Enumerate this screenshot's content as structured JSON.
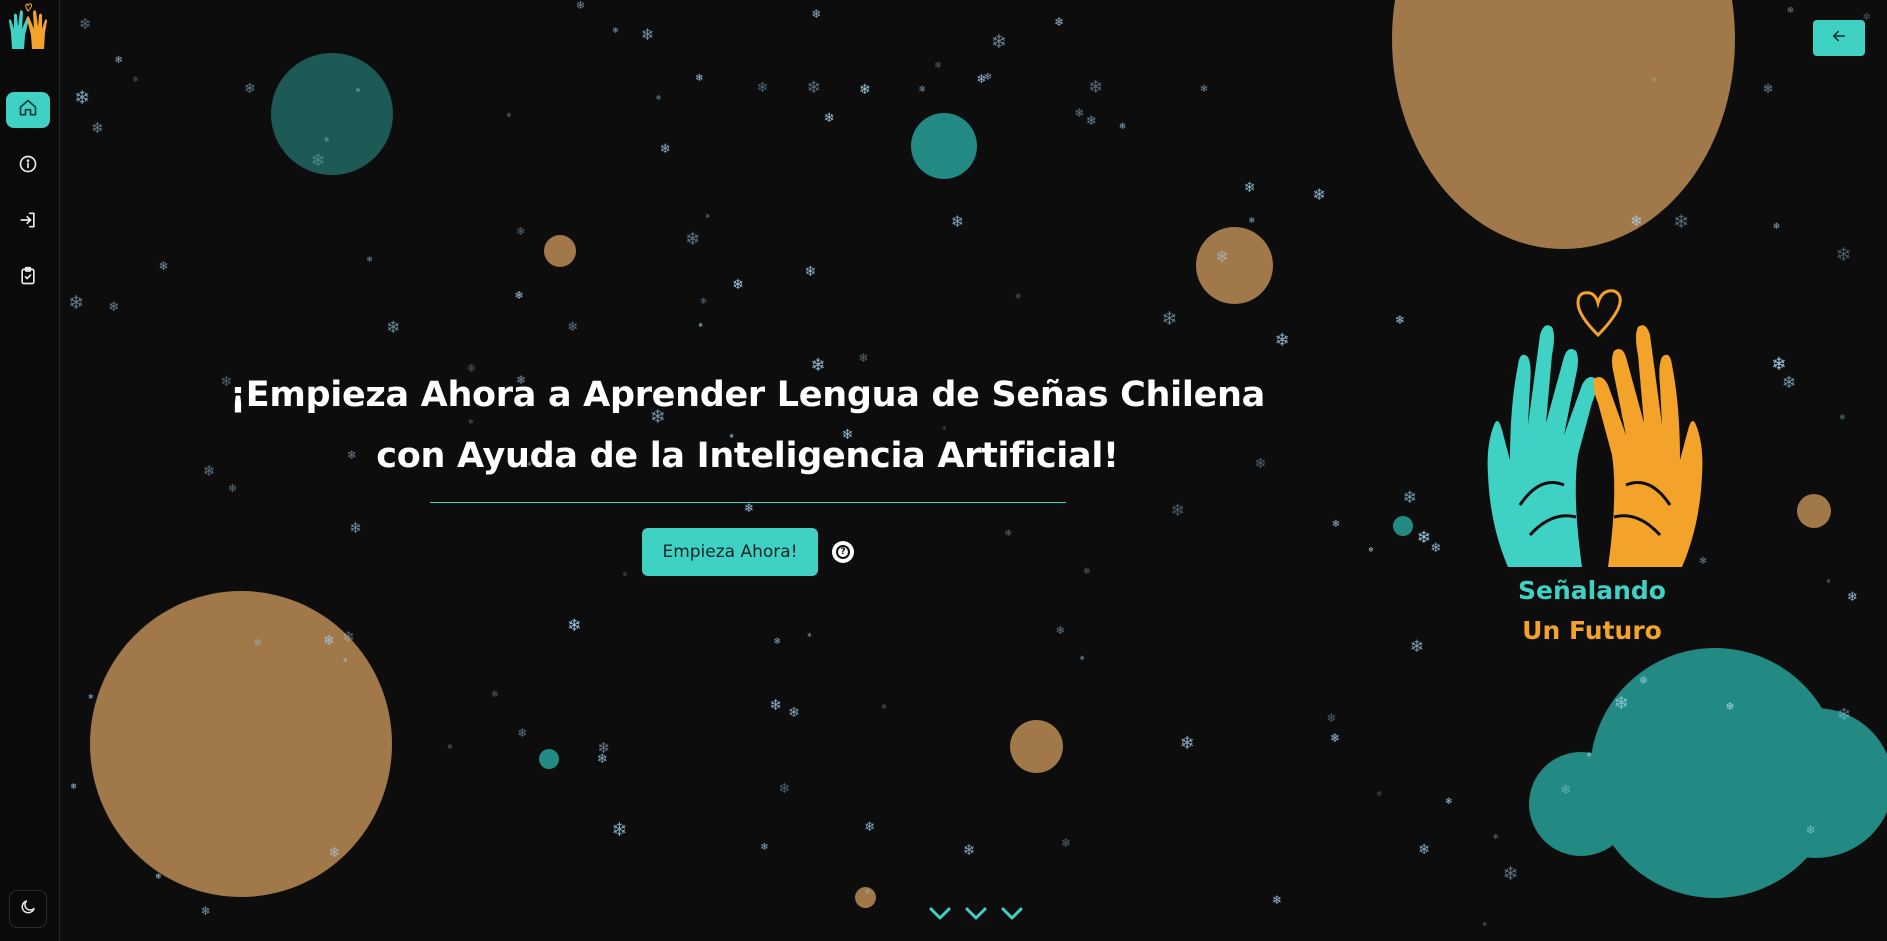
{
  "sidebar": {
    "items": [
      {
        "name": "home",
        "icon": "home-icon",
        "active": true
      },
      {
        "name": "info",
        "icon": "info-icon",
        "active": false
      },
      {
        "name": "login",
        "icon": "login-icon",
        "active": false
      },
      {
        "name": "clipboard",
        "icon": "clipboard-check-icon",
        "active": false
      }
    ],
    "theme_icon": "moon-icon"
  },
  "header": {
    "back_icon": "arrow-left-icon"
  },
  "hero": {
    "title": "¡Empieza Ahora a Aprender Lengua de Señas Chilena con Ayuda de la Inteligencia Artificial!",
    "cta_label": "Empieza Ahora!",
    "help_icon": "question-circle-icon"
  },
  "brand": {
    "line1": "Señalando",
    "line2": "Un Futuro"
  },
  "scroll_hint_icon": "chevron-down-icon",
  "colors": {
    "background": "#0d0d0e",
    "accent_teal": "#40d1c5",
    "accent_orange": "#f3a22a",
    "circle_brown": "#a0784a",
    "circle_teal_dark": "#1d5a55",
    "circle_teal": "#238a83",
    "snow": "#a7d4f0"
  }
}
